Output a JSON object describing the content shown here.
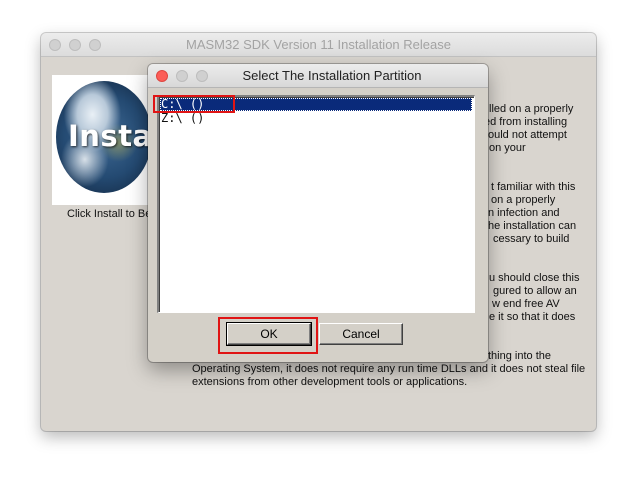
{
  "main_window": {
    "title": "MASM32 SDK Version 11 Installation Release",
    "logo_text": "Install",
    "click_install_text": "Click Install to Be",
    "side_texts": [
      "lled on a properly",
      "ed from installing",
      "ould not attempt",
      "on your",
      "t familiar with this",
      "on a properly",
      "n infection and",
      "he installation can",
      "cessary to build",
      "u should close this",
      "gured to allow an",
      "w end free AV",
      "e it so that it does",
      "thing into the"
    ],
    "bottom_lines": [
      "Operating System, it does not require any run time DLLs and it does not steal file",
      "extensions from other development tools or applications."
    ]
  },
  "dialog": {
    "title": "Select The Installation Partition",
    "partitions": [
      "C:\\ ()",
      "Z:\\ ()"
    ],
    "ok_label": "OK",
    "cancel_label": "Cancel"
  },
  "colors": {
    "selection": "#0a2a7a",
    "annotation_red": "#e01414",
    "close_button": "#fc5d57"
  }
}
